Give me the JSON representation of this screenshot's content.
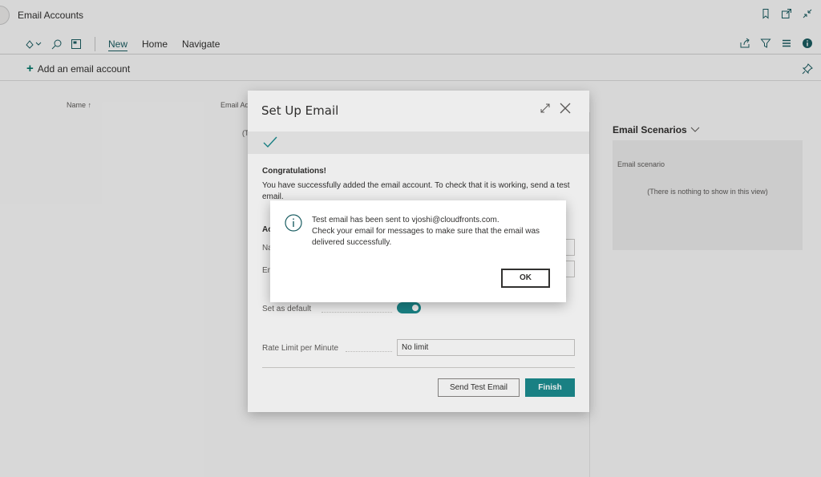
{
  "page": {
    "title": "Email Accounts",
    "menu": [
      "New",
      "Home",
      "Navigate"
    ],
    "add_action": "Add an email account",
    "columns": {
      "name": "Name ↑",
      "email": "Email Ad"
    },
    "list_empty": "(T"
  },
  "factbox": {
    "title": "Email Scenarios",
    "column": "Email scenario",
    "empty": "(There is nothing to show in this view)"
  },
  "setup_dialog": {
    "title": "Set Up Email",
    "congrats_title": "Congratulations!",
    "congrats_text": "You have successfully added the email account. To check that it is working, send a test email.",
    "section_label": "Ac",
    "name_label": "Na",
    "email_label": "En",
    "default_label": "Set as default",
    "default_on": true,
    "rate_label": "Rate Limit per Minute",
    "rate_value": "No limit",
    "send_test_label": "Send Test Email",
    "finish_label": "Finish"
  },
  "message": {
    "line1": "Test email has been sent to vjoshi@cloudfronts.com.",
    "line2": "Check your email for messages to make sure that the email was delivered successfully.",
    "ok_label": "OK"
  },
  "colors": {
    "accent": "#1b8a8d",
    "add_icon": "#00796b",
    "info": "#1b5e63"
  }
}
